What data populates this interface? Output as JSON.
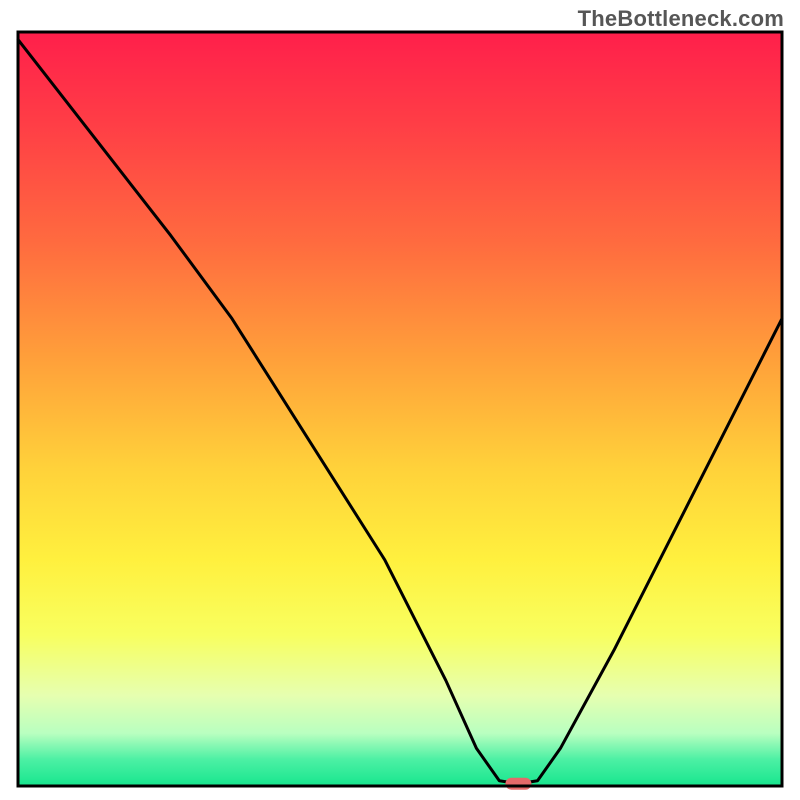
{
  "watermark": "TheBottleneck.com",
  "chart_data": {
    "type": "line",
    "title": "",
    "xlabel": "",
    "ylabel": "",
    "xlim": [
      0,
      100
    ],
    "ylim": [
      0,
      100
    ],
    "grid": false,
    "legend": false,
    "description": "Single black V-shaped curve over a vertical heat gradient background (red at top through orange/yellow to green at bottom). A small red lozenge marks the minimum of the curve near the bottom.",
    "series": [
      {
        "name": "bottleneck-curve",
        "x": [
          0,
          10,
          20,
          28,
          38,
          48,
          56,
          60,
          63,
          65.5,
          68,
          71,
          78,
          88,
          100
        ],
        "y": [
          99,
          86,
          73,
          62,
          46,
          30,
          14,
          5,
          0.7,
          0.3,
          0.7,
          5,
          18,
          38,
          62
        ]
      }
    ],
    "marker": {
      "name": "optimum-marker",
      "x": 65.5,
      "y": 0.3,
      "color": "#e46a6a"
    },
    "gradient_stops": [
      {
        "offset": 0.0,
        "color": "#ff1f4b"
      },
      {
        "offset": 0.12,
        "color": "#ff3d46"
      },
      {
        "offset": 0.28,
        "color": "#ff6b3f"
      },
      {
        "offset": 0.44,
        "color": "#ffa23a"
      },
      {
        "offset": 0.58,
        "color": "#ffd23a"
      },
      {
        "offset": 0.7,
        "color": "#fff03e"
      },
      {
        "offset": 0.8,
        "color": "#f8ff60"
      },
      {
        "offset": 0.88,
        "color": "#e6ffb0"
      },
      {
        "offset": 0.93,
        "color": "#b9ffc0"
      },
      {
        "offset": 0.965,
        "color": "#4cf0a4"
      },
      {
        "offset": 1.0,
        "color": "#17e68e"
      }
    ],
    "frame": {
      "stroke": "#000000",
      "stroke_width": 3
    }
  }
}
